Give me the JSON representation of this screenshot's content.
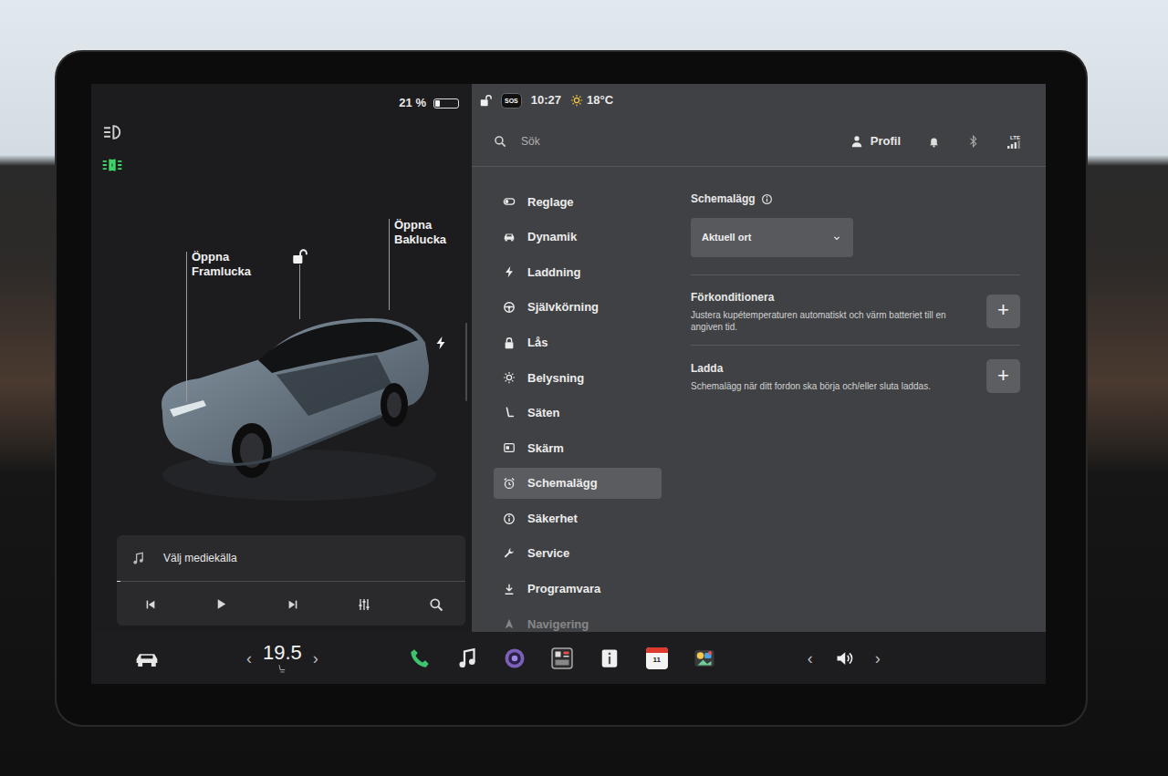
{
  "left_panel": {
    "battery": {
      "reading": "21 %",
      "level": 0.21
    },
    "lights": [
      {
        "kind": "headlights",
        "on": false
      },
      {
        "kind": "parking",
        "on": true
      }
    ],
    "car_labels": [
      {
        "lines": [
          "Öppna",
          "Framlucka"
        ]
      },
      {
        "lines": [
          "Öppna",
          "Baklucka"
        ]
      }
    ],
    "doors_locked": false,
    "media": {
      "source": "Välj mediekälla",
      "playing": false
    }
  },
  "status_bar": {
    "locked": false,
    "sos": "SOS",
    "time": "10:27",
    "temperature": "18°C"
  },
  "top_bar": {
    "search": {
      "placeholder": "Sök"
    },
    "profile": "Profil",
    "network": "LTE"
  },
  "menu": {
    "items": [
      {
        "label": "Reglage",
        "kind": "toggle",
        "selected": false,
        "faded": false
      },
      {
        "label": "Dynamik",
        "kind": "car",
        "selected": false,
        "faded": false
      },
      {
        "label": "Laddning",
        "kind": "bolt",
        "selected": false,
        "faded": false
      },
      {
        "label": "Självkörning",
        "kind": "wheel",
        "selected": false,
        "faded": false
      },
      {
        "label": "Lås",
        "kind": "lock",
        "selected": false,
        "faded": false
      },
      {
        "label": "Belysning",
        "kind": "sun",
        "selected": false,
        "faded": false
      },
      {
        "label": "Säten",
        "kind": "seat",
        "selected": false,
        "faded": false
      },
      {
        "label": "Skärm",
        "kind": "screen",
        "selected": false,
        "faded": false
      },
      {
        "label": "Schemalägg",
        "kind": "alarm",
        "selected": true,
        "faded": false
      },
      {
        "label": "Säkerhet",
        "kind": "info",
        "selected": false,
        "faded": false
      },
      {
        "label": "Service",
        "kind": "wrench",
        "selected": false,
        "faded": false
      },
      {
        "label": "Programvara",
        "kind": "download",
        "selected": false,
        "faded": false
      },
      {
        "label": "Navigering",
        "kind": "nav",
        "selected": false,
        "faded": true
      }
    ]
  },
  "content": {
    "title": "Schemalägg",
    "location": {
      "value": "Aktuell ort"
    },
    "sections": [
      {
        "title": "Förkonditionera",
        "description": "Justera kupétemperaturen automatiskt och värm batteriet till en angiven tid.",
        "button": "+"
      },
      {
        "title": "Ladda",
        "description": "Schemalägg när ditt fordon ska börja och/eller sluta laddas.",
        "button": "+"
      }
    ]
  },
  "bottom_bar": {
    "temp_down": "‹",
    "cabin_temperature": "19.5",
    "temp_up": "›",
    "apps": [
      {
        "kind": "phone"
      },
      {
        "kind": "music"
      },
      {
        "kind": "camera"
      },
      {
        "kind": "dashcam"
      },
      {
        "kind": "manual"
      },
      {
        "kind": "calendar",
        "label": "11"
      },
      {
        "kind": "arcade"
      }
    ],
    "volume_down": "‹",
    "volume_up": "›"
  }
}
